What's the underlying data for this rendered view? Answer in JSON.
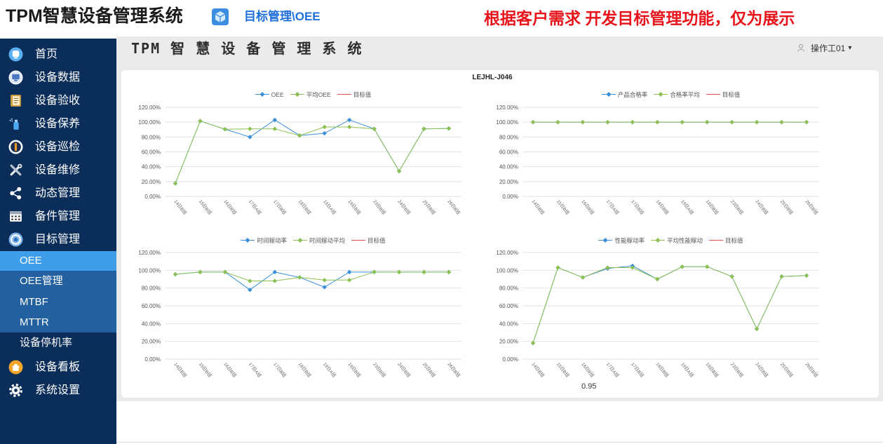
{
  "header": {
    "system_title": "TPM智慧设备管理系统",
    "breadcrumb": "目标管理\\OEE",
    "notice": "根据客户需求 开发目标管理功能，仅为展示",
    "breadcrumb_icon": "cube-icon"
  },
  "topbar": {
    "title": "TPM 智 慧 设 备 管 理 系 统",
    "user": "操作工01",
    "caret": "▾",
    "user_icon": "user-icon"
  },
  "sidebar": {
    "items": [
      {
        "label": "首页",
        "icon": "home-icon"
      },
      {
        "label": "设备数据",
        "icon": "monitor-icon"
      },
      {
        "label": "设备验收",
        "icon": "notebook-icon"
      },
      {
        "label": "设备保养",
        "icon": "spray-icon"
      },
      {
        "label": "设备巡检",
        "icon": "inspection-icon"
      },
      {
        "label": "设备维修",
        "icon": "tools-icon"
      },
      {
        "label": "动态管理",
        "icon": "share-icon"
      },
      {
        "label": "备件管理",
        "icon": "calendar-icon"
      },
      {
        "label": "目标管理",
        "icon": "target-icon",
        "children": [
          {
            "label": "OEE",
            "active": true
          },
          {
            "label": "OEE管理"
          },
          {
            "label": "MTBF"
          },
          {
            "label": "MTTR"
          },
          {
            "label": "设备停机率"
          }
        ]
      },
      {
        "label": "设备看板",
        "icon": "house-icon"
      },
      {
        "label": "系统设置",
        "icon": "gear-icon"
      }
    ]
  },
  "card": {
    "title": "LEJHL-J046",
    "footnote": "0.95"
  },
  "colors": {
    "sidebar": "#0b2d59",
    "active_item": "#3f9de9",
    "breadcrumb": "#1f6fd9",
    "notice": "#e8141b",
    "series_primary": "#3a8fd9",
    "series_average": "#8cc152",
    "series_target": "#d9534f"
  },
  "chart_data": [
    {
      "type": "line",
      "categories": [
        "14日B班",
        "15日B班",
        "16日B班",
        "17日A班",
        "17日B班",
        "18日B班",
        "19日A班",
        "19日B班",
        "23日B班",
        "24日B班",
        "25日B班",
        "26日B班"
      ],
      "y_ticks": [
        0,
        20,
        40,
        60,
        80,
        100,
        120
      ],
      "y_tick_labels": [
        "0.00%",
        "20.00%",
        "40.00%",
        "60.00%",
        "80.00%",
        "100.00%",
        "120.00%"
      ],
      "ylim": [
        0,
        120
      ],
      "grid": true,
      "legend": "top-center",
      "series": [
        {
          "name": "OEE",
          "color": "#3a8fd9",
          "values": [
            17.5,
            101.5,
            90.5,
            80,
            103,
            82,
            85,
            103,
            91,
            34,
            91,
            91.5
          ]
        },
        {
          "name": "平均OEE",
          "color": "#8cc152",
          "values": [
            17.5,
            101.5,
            90.5,
            91,
            91,
            82,
            93.5,
            93.5,
            91,
            34,
            91,
            91.5
          ]
        },
        {
          "name": "目标值",
          "color": "#d9534f",
          "values": []
        }
      ]
    },
    {
      "type": "line",
      "categories": [
        "14日B班",
        "15日B班",
        "16日B班",
        "17日A班",
        "17日B班",
        "18日B班",
        "19日A班",
        "19日B班",
        "23日B班",
        "24日B班",
        "25日B班",
        "26日B班"
      ],
      "y_ticks": [
        0,
        20,
        40,
        60,
        80,
        100,
        120
      ],
      "y_tick_labels": [
        "0.00%",
        "20.00%",
        "40.00%",
        "60.00%",
        "80.00%",
        "100.00%",
        "120.00%"
      ],
      "ylim": [
        0,
        120
      ],
      "grid": true,
      "legend": "top-center",
      "series": [
        {
          "name": "产品合格率",
          "color": "#3a8fd9",
          "values": [
            100,
            100,
            100,
            100,
            100,
            100,
            100,
            100,
            100,
            100,
            100,
            100
          ]
        },
        {
          "name": "合格率平均",
          "color": "#8cc152",
          "values": [
            100,
            100,
            100,
            100,
            100,
            100,
            100,
            100,
            100,
            100,
            100,
            100
          ]
        },
        {
          "name": "目标值",
          "color": "#d9534f",
          "values": []
        }
      ]
    },
    {
      "type": "line",
      "categories": [
        "14日B班",
        "15日B班",
        "16日B班",
        "17日A班",
        "17日B班",
        "18日B班",
        "19日A班",
        "19日B班",
        "23日B班",
        "24日B班",
        "25日B班",
        "26日B班"
      ],
      "y_ticks": [
        0,
        20,
        40,
        60,
        80,
        100,
        120
      ],
      "y_tick_labels": [
        "0.00%",
        "20.00%",
        "40.00%",
        "60.00%",
        "80.00%",
        "100.00%",
        "120.00%"
      ],
      "ylim": [
        0,
        120
      ],
      "grid": true,
      "legend": "top-center",
      "series": [
        {
          "name": "时间稼动率",
          "color": "#3a8fd9",
          "values": [
            95.5,
            98,
            98,
            78,
            98,
            92,
            81,
            98,
            98,
            98,
            98,
            98
          ]
        },
        {
          "name": "时间稼动平均",
          "color": "#8cc152",
          "values": [
            95.5,
            98,
            98,
            88,
            88,
            92,
            89,
            89,
            98,
            98,
            98,
            98
          ]
        },
        {
          "name": "目标值",
          "color": "#d9534f",
          "values": []
        }
      ]
    },
    {
      "type": "line",
      "categories": [
        "14日B班",
        "15日B班",
        "16日B班",
        "17日A班",
        "17日B班",
        "18日B班",
        "19日A班",
        "19日B班",
        "23日B班",
        "24日B班",
        "25日B班",
        "26日B班"
      ],
      "y_ticks": [
        0,
        20,
        40,
        60,
        80,
        100,
        120
      ],
      "y_tick_labels": [
        "0.00%",
        "20.00%",
        "40.00%",
        "60.00%",
        "80.00%",
        "100.00%",
        "120.00%"
      ],
      "ylim": [
        0,
        120
      ],
      "grid": true,
      "legend": "top-center",
      "series": [
        {
          "name": "性能稼动率",
          "color": "#3a8fd9",
          "values": [
            18,
            103,
            92,
            102,
            105,
            90,
            104,
            104,
            93,
            34,
            93,
            94
          ]
        },
        {
          "name": "平均性能稼动",
          "color": "#8cc152",
          "values": [
            18,
            103,
            92,
            103,
            103,
            90,
            104,
            104,
            93,
            34,
            93,
            94
          ]
        },
        {
          "name": "目标值",
          "color": "#d9534f",
          "values": []
        }
      ]
    }
  ]
}
